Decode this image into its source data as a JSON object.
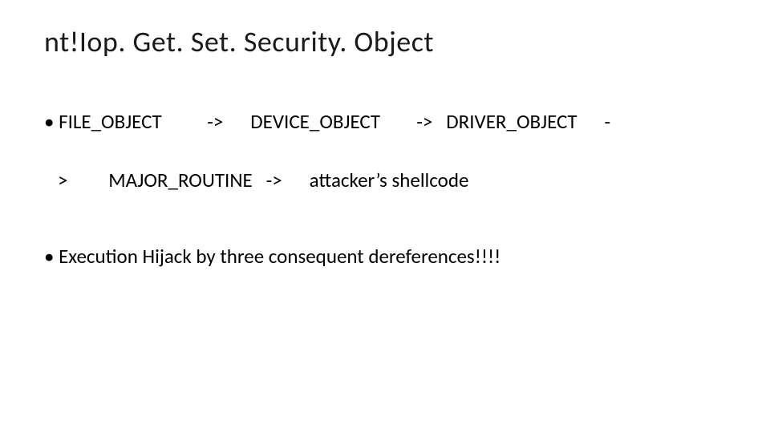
{
  "title": "nt!Iop. Get. Set. Security. Object",
  "line1_bullet": "•",
  "line1_text": " FILE_OBJECT          ->      DEVICE_OBJECT        ->   DRIVER_OBJECT      -",
  "line2_prefix": "   >         MAJOR_ROUTINE   ->      attacker’s shellcode",
  "line3_bullet": "•",
  "line3_text": " Execution Hijack by three consequent dereferences!!!!"
}
